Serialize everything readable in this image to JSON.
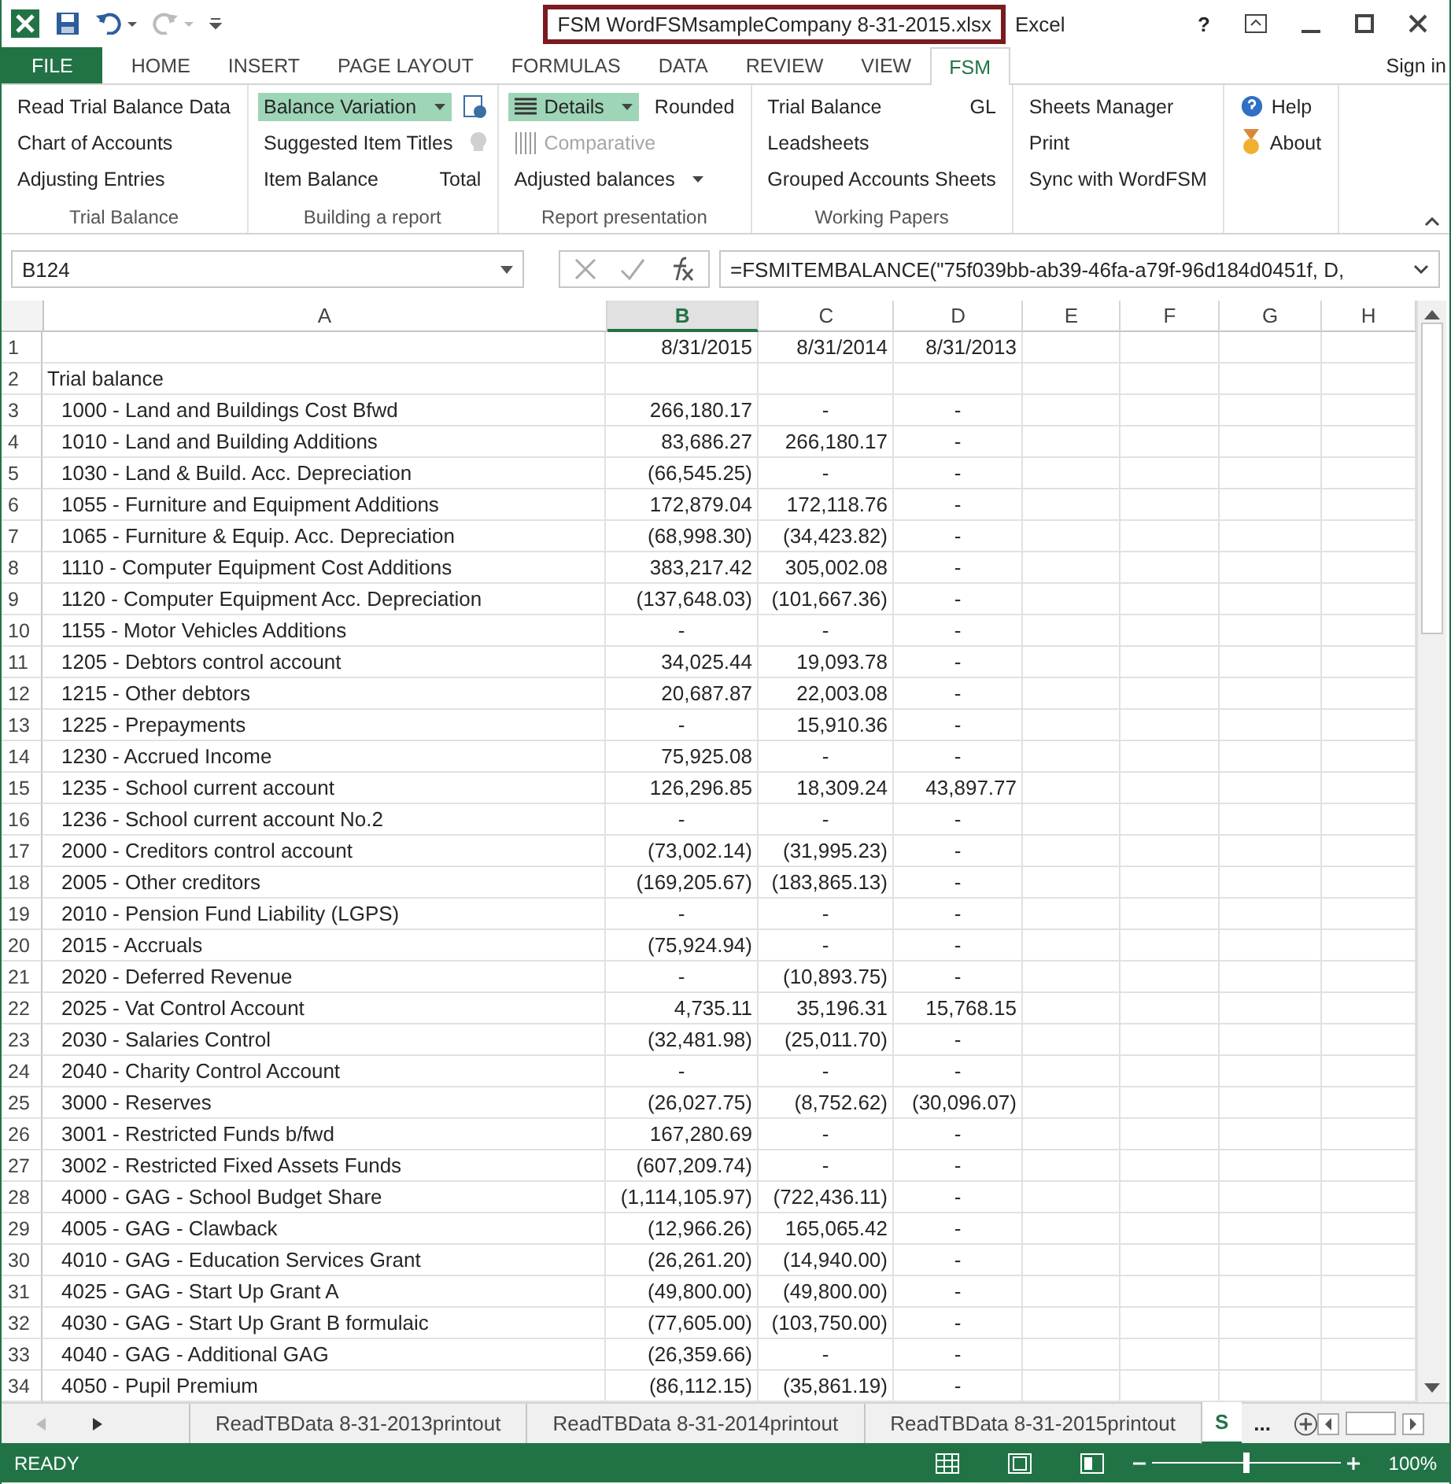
{
  "window": {
    "title": "FSM WordFSMsampleCompany 8-31-2015.xlsx",
    "app": "Excel",
    "help": "?"
  },
  "ribbon_tabs": [
    {
      "label": "FILE",
      "kind": "file",
      "selected": false
    },
    {
      "label": "HOME",
      "kind": "tab",
      "selected": false
    },
    {
      "label": "INSERT",
      "kind": "tab",
      "selected": false
    },
    {
      "label": "PAGE LAYOUT",
      "kind": "tab",
      "selected": false
    },
    {
      "label": "FORMULAS",
      "kind": "tab",
      "selected": false
    },
    {
      "label": "DATA",
      "kind": "tab",
      "selected": false
    },
    {
      "label": "REVIEW",
      "kind": "tab",
      "selected": false
    },
    {
      "label": "VIEW",
      "kind": "tab",
      "selected": false
    },
    {
      "label": "FSM",
      "kind": "tab",
      "selected": true
    }
  ],
  "sign_in": "Sign in",
  "ribbon_groups": [
    {
      "name": "Trial Balance",
      "rows": [
        [
          {
            "label": "Read Trial Balance Data"
          }
        ],
        [
          {
            "label": "Chart of Accounts"
          }
        ],
        [
          {
            "label": "Adjusting Entries"
          }
        ]
      ]
    },
    {
      "name": "Building a report",
      "rows": [
        [
          {
            "label": "Balance Variation",
            "dropdown": true,
            "selected": true
          }
        ],
        [
          {
            "label": "Suggested Item Titles"
          }
        ],
        [
          {
            "label": "Item Balance"
          },
          {
            "label": "Total"
          }
        ]
      ]
    },
    {
      "name": "Report presentation",
      "rows": [
        [
          {
            "label": "Details",
            "dropdown": true,
            "selected": true
          },
          {
            "label": "Rounded"
          }
        ],
        [
          {
            "label": "Comparative",
            "disabled": true
          }
        ],
        [
          {
            "label": "Adjusted balances",
            "dropdown": true
          }
        ]
      ]
    },
    {
      "name": "Working Papers",
      "rows": [
        [
          {
            "label": "Trial Balance"
          },
          {
            "label": "GL"
          }
        ],
        [
          {
            "label": "Leadsheets"
          }
        ],
        [
          {
            "label": "Grouped Accounts Sheets"
          }
        ]
      ]
    },
    {
      "rows": [
        [
          {
            "label": "Sheets Manager"
          }
        ],
        [
          {
            "label": "Print"
          }
        ],
        [
          {
            "label": "Sync with WordFSM"
          }
        ]
      ]
    },
    {
      "rows": [
        [
          {
            "label": "Help"
          }
        ],
        [
          {
            "label": "About"
          }
        ]
      ]
    }
  ],
  "formula_bar": {
    "name_box": "B124",
    "formula": "=FSMITEMBALANCE(\"75f039bb-ab39-46fa-a79f-96d184d0451f, D,"
  },
  "columns": [
    {
      "label": "A",
      "selected": false
    },
    {
      "label": "B",
      "selected": true
    },
    {
      "label": "C",
      "selected": false
    },
    {
      "label": "D",
      "selected": false
    },
    {
      "label": "E",
      "selected": false
    },
    {
      "label": "F",
      "selected": false
    },
    {
      "label": "G",
      "selected": false
    },
    {
      "label": "H",
      "selected": false
    }
  ],
  "rows": [
    {
      "num": "1",
      "kind": "header",
      "b": "8/31/2015",
      "c": "8/31/2014",
      "d": "8/31/2013"
    },
    {
      "num": "2",
      "kind": "heading",
      "a": "Trial balance"
    },
    {
      "num": "3",
      "kind": "account",
      "a": "1000 - Land and Buildings Cost Bfwd",
      "b": "266,180.17",
      "c": "-",
      "d": "-"
    },
    {
      "num": "4",
      "kind": "account",
      "a": "1010 - Land and Building Additions",
      "b": "83,686.27",
      "c": "266,180.17",
      "d": "-"
    },
    {
      "num": "5",
      "kind": "account",
      "a": "1030 - Land & Build. Acc. Depreciation",
      "b": "(66,545.25)",
      "c": "-",
      "d": "-"
    },
    {
      "num": "6",
      "kind": "account",
      "a": "1055 - Furniture and Equipment Additions",
      "b": "172,879.04",
      "c": "172,118.76",
      "d": "-"
    },
    {
      "num": "7",
      "kind": "account",
      "a": "1065 - Furniture & Equip. Acc. Depreciation",
      "b": "(68,998.30)",
      "c": "(34,423.82)",
      "d": "-"
    },
    {
      "num": "8",
      "kind": "account",
      "a": "1110 - Computer Equipment Cost Additions",
      "b": "383,217.42",
      "c": "305,002.08",
      "d": "-"
    },
    {
      "num": "9",
      "kind": "account",
      "a": "1120 - Computer Equipment Acc. Depreciation",
      "b": "(137,648.03)",
      "c": "(101,667.36)",
      "d": "-"
    },
    {
      "num": "10",
      "kind": "account",
      "a": "1155 - Motor Vehicles Additions",
      "b": "-",
      "c": "-",
      "d": "-"
    },
    {
      "num": "11",
      "kind": "account",
      "a": "1205 - Debtors control account",
      "b": "34,025.44",
      "c": "19,093.78",
      "d": "-"
    },
    {
      "num": "12",
      "kind": "account",
      "a": "1215 - Other debtors",
      "b": "20,687.87",
      "c": "22,003.08",
      "d": "-"
    },
    {
      "num": "13",
      "kind": "account",
      "a": "1225 - Prepayments",
      "b": "-",
      "c": "15,910.36",
      "d": "-"
    },
    {
      "num": "14",
      "kind": "account",
      "a": "1230 - Accrued Income",
      "b": "75,925.08",
      "c": "-",
      "d": "-"
    },
    {
      "num": "15",
      "kind": "account",
      "a": "1235 - School current account",
      "b": "126,296.85",
      "c": "18,309.24",
      "d": "43,897.77"
    },
    {
      "num": "16",
      "kind": "account",
      "a": "1236 - School current account No.2",
      "b": "-",
      "c": "-",
      "d": "-"
    },
    {
      "num": "17",
      "kind": "account",
      "a": "2000 - Creditors control account",
      "b": "(73,002.14)",
      "c": "(31,995.23)",
      "d": "-"
    },
    {
      "num": "18",
      "kind": "account",
      "a": "2005 - Other creditors",
      "b": "(169,205.67)",
      "c": "(183,865.13)",
      "d": "-"
    },
    {
      "num": "19",
      "kind": "account",
      "a": "2010 - Pension Fund Liability (LGPS)",
      "b": "-",
      "c": "-",
      "d": "-"
    },
    {
      "num": "20",
      "kind": "account",
      "a": "2015 - Accruals",
      "b": "(75,924.94)",
      "c": "-",
      "d": "-"
    },
    {
      "num": "21",
      "kind": "account",
      "a": "2020 - Deferred Revenue",
      "b": "-",
      "c": "(10,893.75)",
      "d": "-"
    },
    {
      "num": "22",
      "kind": "account",
      "a": "2025 - Vat Control Account",
      "b": "4,735.11",
      "c": "35,196.31",
      "d": "15,768.15"
    },
    {
      "num": "23",
      "kind": "account",
      "a": "2030 - Salaries Control",
      "b": "(32,481.98)",
      "c": "(25,011.70)",
      "d": "-"
    },
    {
      "num": "24",
      "kind": "account",
      "a": "2040 - Charity Control Account",
      "b": "-",
      "c": "-",
      "d": "-"
    },
    {
      "num": "25",
      "kind": "account",
      "a": "3000 - Reserves",
      "b": "(26,027.75)",
      "c": "(8,752.62)",
      "d": "(30,096.07)"
    },
    {
      "num": "26",
      "kind": "account",
      "a": "3001 - Restricted Funds b/fwd",
      "b": "167,280.69",
      "c": "-",
      "d": "-"
    },
    {
      "num": "27",
      "kind": "account",
      "a": "3002 - Restricted Fixed Assets Funds",
      "b": "(607,209.74)",
      "c": "-",
      "d": "-"
    },
    {
      "num": "28",
      "kind": "account",
      "a": "4000 - GAG - School Budget Share",
      "b": "(1,114,105.97)",
      "c": "(722,436.11)",
      "d": "-"
    },
    {
      "num": "29",
      "kind": "account",
      "a": "4005 - GAG - Clawback",
      "b": "(12,966.26)",
      "c": "165,065.42",
      "d": "-"
    },
    {
      "num": "30",
      "kind": "account",
      "a": "4010 - GAG - Education Services Grant",
      "b": "(26,261.20)",
      "c": "(14,940.00)",
      "d": "-"
    },
    {
      "num": "31",
      "kind": "account",
      "a": "4025 - GAG - Start Up Grant A",
      "b": "(49,800.00)",
      "c": "(49,800.00)",
      "d": "-"
    },
    {
      "num": "32",
      "kind": "account",
      "a": "4030 - GAG - Start Up Grant B formulaic",
      "b": "(77,605.00)",
      "c": "(103,750.00)",
      "d": "-"
    },
    {
      "num": "33",
      "kind": "account",
      "a": "4040 - GAG - Additional GAG",
      "b": "(26,359.66)",
      "c": "-",
      "d": "-"
    },
    {
      "num": "34",
      "kind": "account",
      "a": "4050 - Pupil Premium",
      "b": "(86,112.15)",
      "c": "(35,861.19)",
      "d": "-"
    }
  ],
  "sheet_tabs": [
    {
      "label": "ReadTBData 8-31-2013printout",
      "selected": false
    },
    {
      "label": "ReadTBData 8-31-2014printout",
      "selected": false
    },
    {
      "label": "ReadTBData 8-31-2015printout",
      "selected": false
    },
    {
      "label": "S",
      "selected": true
    }
  ],
  "more_sheets": "...",
  "status_bar": {
    "mode": "READY",
    "zoom": "100%",
    "zoom_slider": {
      "level": 0.5
    }
  }
}
